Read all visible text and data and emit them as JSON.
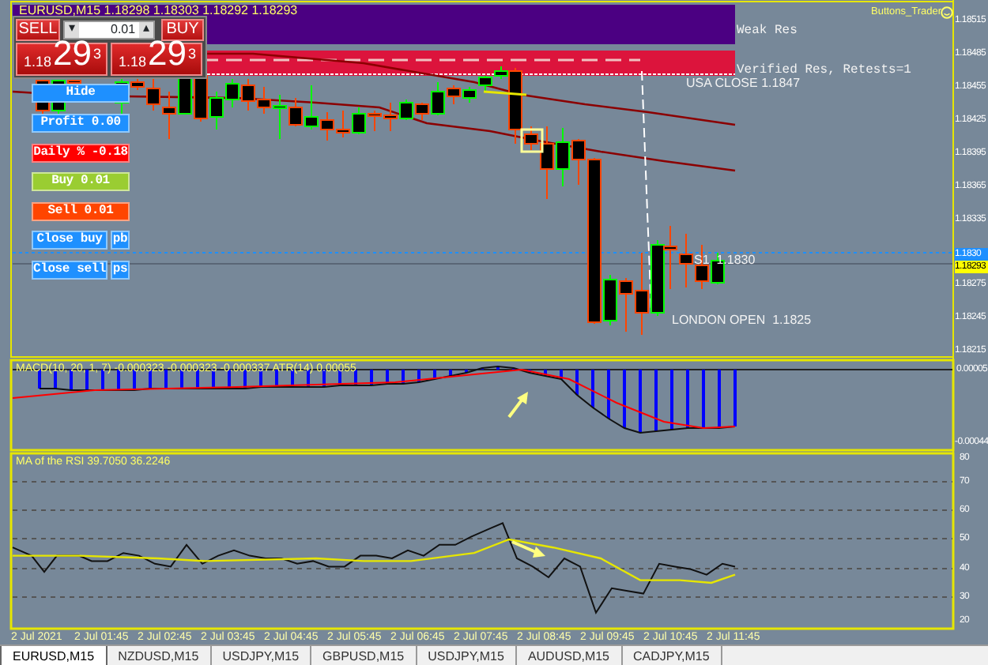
{
  "chart_header": {
    "title": "EURUSD,M15 1.18298 1.18303 1.18292 1.18293"
  },
  "trade_panel": {
    "sell_label": "SELL",
    "buy_label": "BUY",
    "lot": "0.01",
    "down_arrow": "▾",
    "up_arrow": "▴",
    "sell_price": {
      "prefix": "1.18",
      "pips": "29",
      "point": "3"
    },
    "buy_price": {
      "prefix": "1.18",
      "pips": "29",
      "point": "3"
    }
  },
  "buttons": [
    {
      "label": "Hide",
      "color": "#1e90ff"
    },
    {
      "label": "Profit 0.00",
      "color": "#1e90ff"
    },
    {
      "label": "Daily % -0.18",
      "color": "#ff0000"
    },
    {
      "label": "Buy 0.01",
      "color": "#9acd32"
    },
    {
      "label": "Sell 0.01",
      "color": "#ff4500"
    },
    {
      "label": "Close buy",
      "color": "#1e90ff",
      "extra": "pb"
    },
    {
      "label": "Close sell",
      "color": "#1e90ff",
      "extra": "ps"
    }
  ],
  "zones": [
    {
      "label": "Weak Res",
      "color": "#4b0082"
    },
    {
      "label": "Verified Res, Retests=1",
      "color": "#dc143c"
    }
  ],
  "level_labels": [
    "USA CLOSE 1.1847",
    "S1  1.1830",
    "LONDON OPEN  1.1825"
  ],
  "expert_name": "Buttons_Trader",
  "price_axis": [
    {
      "label": "1.18515",
      "kind": "tick"
    },
    {
      "label": "1.18485",
      "kind": "tick"
    },
    {
      "label": "1.18455",
      "kind": "tick"
    },
    {
      "label": "1.18425",
      "kind": "tick"
    },
    {
      "label": "1.18395",
      "kind": "tick"
    },
    {
      "label": "1.18365",
      "kind": "tick"
    },
    {
      "label": "1.18335",
      "kind": "tick"
    },
    {
      "label": "1.1830",
      "kind": "marker",
      "color": "#1e90ff"
    },
    {
      "label": "1.18293",
      "kind": "marker",
      "color": "#ffff00"
    },
    {
      "label": "1.18275",
      "kind": "tick"
    },
    {
      "label": "1.18245",
      "kind": "tick"
    },
    {
      "label": "1.18215",
      "kind": "tick"
    }
  ],
  "macd": {
    "label": "MACD(10, 20, 1, 7) -0.000323 -0.000323 -0.000337  ATR(14) 0.00055",
    "axis": [
      "0.00005",
      "-0.00044"
    ]
  },
  "rsi": {
    "label": "MA of the RSI 39.7050 36.2246",
    "axis": [
      "80",
      "70",
      "60",
      "50",
      "40",
      "30",
      "20"
    ]
  },
  "time_axis": [
    "2 Jul 2021",
    "2 Jul 01:45",
    "2 Jul 02:45",
    "2 Jul 03:45",
    "2 Jul 04:45",
    "2 Jul 05:45",
    "2 Jul 06:45",
    "2 Jul 07:45",
    "2 Jul 08:45",
    "2 Jul 09:45",
    "2 Jul 10:45",
    "2 Jul 11:45"
  ],
  "tabs": [
    {
      "label": "EURUSD,M15",
      "selected": true
    },
    {
      "label": "NZDUSD,M15",
      "selected": false
    },
    {
      "label": "USDJPY,M15",
      "selected": false
    },
    {
      "label": "GBPUSD,M15",
      "selected": false
    },
    {
      "label": "USDJPY,M15",
      "selected": false
    },
    {
      "label": "AUDUSD,M15",
      "selected": false
    },
    {
      "label": "CADJPY,M15",
      "selected": false
    }
  ]
}
